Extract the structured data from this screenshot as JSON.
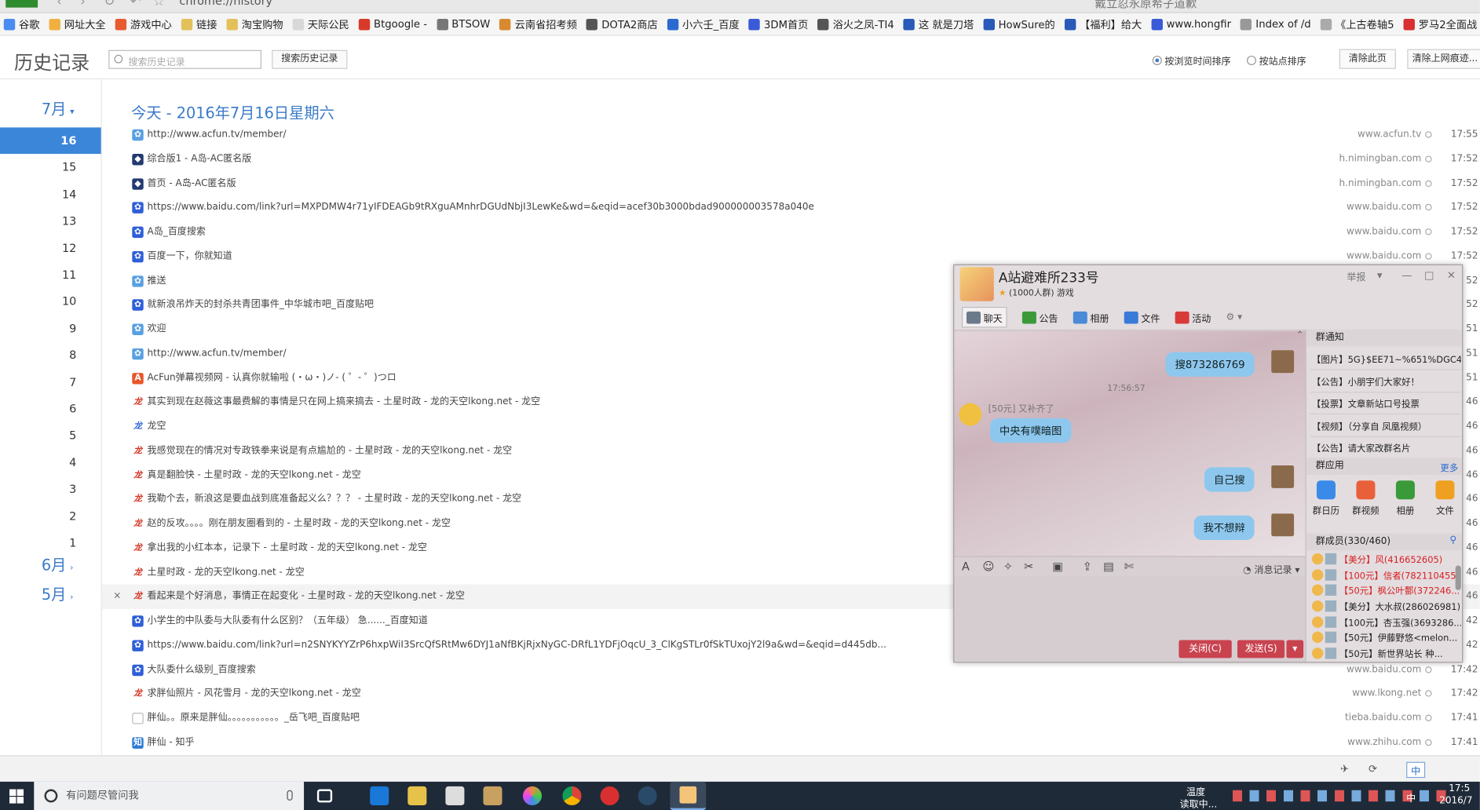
{
  "browser": {
    "url": "chrome://history",
    "tab_title": "戴立忍永原希子道歉",
    "bookmarks": [
      "谷歌",
      "网址大全",
      "游戏中心",
      "链接",
      "淘宝购物",
      "天际公民",
      "Btgoogle -",
      "BTSOW",
      "云南省招考频",
      "DOTA2商店",
      "小六壬_百度",
      "3DM首页",
      "浴火之凤-TI4",
      "这 就是刀塔",
      "HowSure的",
      "【福利】给大",
      "www.hongfir",
      "Index of /d",
      "《上古卷轴5",
      "罗马2全面战"
    ]
  },
  "history": {
    "title": "历史记录",
    "search_placeholder": "搜索历史记录",
    "search_button": "搜索历史记录",
    "sort_by_time": "按浏览时间排序",
    "sort_by_site": "按站点排序",
    "clear_page": "清除此页",
    "clear_all": "清除上网痕迹..."
  },
  "sidebar": {
    "months": [
      "7月",
      "6月",
      "5月"
    ],
    "days": [
      "16",
      "15",
      "14",
      "13",
      "12",
      "11",
      "10",
      "9",
      "8",
      "7",
      "6",
      "5",
      "4",
      "3",
      "2",
      "1"
    ],
    "selected_day": "16"
  },
  "date_heading": "今天 - 2016年7月16日星期六",
  "rows": [
    {
      "title": "http://www.acfun.tv/member/",
      "domain": "www.acfun.tv",
      "time": "17:55",
      "icon": "acfun-icon",
      "color": "#5aa0e0"
    },
    {
      "title": "综合版1 - A岛-AC匿名版",
      "domain": "h.nimingban.com",
      "time": "17:52",
      "icon": "nimingban-icon",
      "color": "#223a70"
    },
    {
      "title": "首页 - A岛-AC匿名版",
      "domain": "h.nimingban.com",
      "time": "17:52",
      "icon": "nimingban-icon",
      "color": "#223a70"
    },
    {
      "title": "https://www.baidu.com/link?url=MXPDMW4r71yIFDEAGb9tRXguAMnhrDGUdNbjI3LewKe&wd=&eqid=acef30b3000bdad900000003578a040e",
      "domain": "www.baidu.com",
      "time": "17:52",
      "icon": "baidu-icon",
      "color": "#2f5fd8"
    },
    {
      "title": "A岛_百度搜索",
      "domain": "www.baidu.com",
      "time": "17:52",
      "icon": "baidu-icon",
      "color": "#2f5fd8"
    },
    {
      "title": "百度一下，你就知道",
      "domain": "www.baidu.com",
      "time": "17:52",
      "icon": "baidu-icon",
      "color": "#2f5fd8"
    },
    {
      "title": "推送",
      "domain": "",
      "time": "",
      "icon": "acfun-icon",
      "color": "#5aa0e0"
    },
    {
      "title": "就新浪吊炸天的封杀共青团事件_中华城市吧_百度贴吧",
      "domain": "",
      "time": "",
      "icon": "baidu-icon",
      "color": "#2f5fd8"
    },
    {
      "title": "欢迎",
      "domain": "",
      "time": "",
      "icon": "acfun-icon",
      "color": "#5aa0e0"
    },
    {
      "title": "http://www.acfun.tv/member/",
      "domain": "",
      "time": "",
      "icon": "acfun-icon",
      "color": "#5aa0e0"
    },
    {
      "title": "AcFun弹幕视频网 - 认真你就输啦 (・ω・)ノ- ( ゜- ゜)つロ",
      "domain": "",
      "time": "",
      "icon": "acfun-logo-icon",
      "color": "#e8552a"
    },
    {
      "title": "其实到现在赵薇这事最费解的事情是只在网上搞来搞去 - 土星时政 - 龙的天空lkong.net - 龙空",
      "domain": "",
      "time": "",
      "icon": "lkong-icon",
      "color": "#d43a2a"
    },
    {
      "title": "龙空",
      "domain": "",
      "time": "",
      "icon": "lkong-blue-icon",
      "color": "#3a6ad8"
    },
    {
      "title": "我感觉现在的情况对专政铁拳来说是有点尴尬的 - 土星时政 - 龙的天空lkong.net - 龙空",
      "domain": "",
      "time": "",
      "icon": "lkong-icon",
      "color": "#d43a2a"
    },
    {
      "title": "真是翻脸快 - 土星时政 - 龙的天空lkong.net - 龙空",
      "domain": "",
      "time": "",
      "icon": "lkong-icon",
      "color": "#d43a2a"
    },
    {
      "title": "我勒个去，新浪这是要血战到底准备起义么？？？ - 土星时政 - 龙的天空lkong.net - 龙空",
      "domain": "",
      "time": "",
      "icon": "lkong-icon",
      "color": "#d43a2a"
    },
    {
      "title": "赵的反攻。。。。刚在朋友圈看到的 - 土星时政 - 龙的天空lkong.net - 龙空",
      "domain": "",
      "time": "",
      "icon": "lkong-icon",
      "color": "#d43a2a"
    },
    {
      "title": "拿出我的小红本本，记录下 - 土星时政 - 龙的天空lkong.net - 龙空",
      "domain": "",
      "time": "",
      "icon": "lkong-icon",
      "color": "#d43a2a"
    },
    {
      "title": "土星时政 - 龙的天空lkong.net - 龙空",
      "domain": "",
      "time": "",
      "icon": "lkong-icon",
      "color": "#d43a2a"
    },
    {
      "title": "看起来是个好消息，事情正在起变化 - 土星时政 - 龙的天空lkong.net - 龙空",
      "domain": "",
      "time": "",
      "icon": "lkong-icon",
      "color": "#d43a2a"
    },
    {
      "title": "小学生的中队委与大队委有什么区别？（五年级） 急......_百度知道",
      "domain": "",
      "time": "",
      "icon": "baidu-icon",
      "color": "#2f5fd8"
    },
    {
      "title": "https://www.baidu.com/link?url=n2SNYKYYZrP6hxpWiI3SrcQfSRtMw6DYJ1aNfBKjRjxNyGC-DRfL1YDFjOqcU_3_ClKgSTLr0fSkTUxojY2l9a&wd=&eqid=d445db...",
      "domain": "",
      "time": "",
      "icon": "baidu-icon",
      "color": "#2f5fd8"
    },
    {
      "title": "大队委什么级别_百度搜索",
      "domain": "www.baidu.com",
      "time": "17:42",
      "icon": "baidu-icon",
      "color": "#2f5fd8"
    },
    {
      "title": "求胖仙照片 - 风花雪月 - 龙的天空lkong.net - 龙空",
      "domain": "www.lkong.net",
      "time": "17:42",
      "icon": "lkong-icon",
      "color": "#d43a2a"
    },
    {
      "title": "胖仙。。原来是胖仙。。。。。。。。。。。_岳飞吧_百度贴吧",
      "domain": "tieba.baidu.com",
      "time": "17:41",
      "icon": "page-icon",
      "color": "#bbbbbb"
    },
    {
      "title": "胖仙 - 知乎",
      "domain": "www.zhihu.com",
      "time": "17:41",
      "icon": "zhihu-icon",
      "color": "#2c7ad6"
    }
  ],
  "right_times": [
    "17:55",
    "17:52",
    "17:52",
    "17:52",
    "17:52",
    "17:52",
    "52",
    "52",
    "51",
    "51",
    "51",
    "46",
    "46",
    "46",
    "46",
    "46",
    "46",
    "46",
    "46",
    "46",
    "42",
    "42"
  ],
  "delete_mark": "×",
  "qq": {
    "group_name": "A站避难所233号",
    "group_sub": "(1000人群) 游戏",
    "report": "举报",
    "tabs": [
      "聊天",
      "公告",
      "相册",
      "文件",
      "活动"
    ],
    "chat_time": "17:56:57",
    "messages": [
      {
        "side": "right",
        "text": "搜873286769"
      },
      {
        "side": "left",
        "tag": "[50元] 又补齐了",
        "text": "中央有噗暗图"
      },
      {
        "side": "right",
        "text": "自己搜"
      },
      {
        "side": "right",
        "text": "我不想辩"
      }
    ],
    "history_label": "消息记录",
    "close": "关闭(C)",
    "send": "发送(S)",
    "notice_title": "群通知",
    "notices": [
      "【图片】5G}$EE71~%651%DGC4%V...",
      "【公告】小朋宇们大家好！",
      "【投票】文章新站口号投票",
      "【视频】（分享自 凤凰视频）",
      "【公告】请大家改群名片"
    ],
    "apps_title": "群应用",
    "apps_more": "更多",
    "apps": [
      "群日历",
      "群视频",
      "相册",
      "文件"
    ],
    "members_title": "群成员(330/460)",
    "members": [
      {
        "text": "【美分】风(416652605)",
        "color": "#d82020"
      },
      {
        "text": "【100元】信者(782110455)",
        "color": "#d82020"
      },
      {
        "text": "【50元】枫公叶酆(372246...",
        "color": "#d82020"
      },
      {
        "text": "【美分】大水叔(286026981)",
        "color": "#222222"
      },
      {
        "text": "【100元】杏玉强(3693286...",
        "color": "#222222"
      },
      {
        "text": "【50元】伊藤野悠<melon...",
        "color": "#222222"
      },
      {
        "text": "【50元】新世界站长 种...",
        "color": "#222222"
      }
    ]
  },
  "taskbar": {
    "search_placeholder": "有问题尽管问我",
    "tray_line1": "温度",
    "tray_line2": "读取中...",
    "ime": "中",
    "clock_time": "17:5",
    "clock_date": "2016/7"
  }
}
